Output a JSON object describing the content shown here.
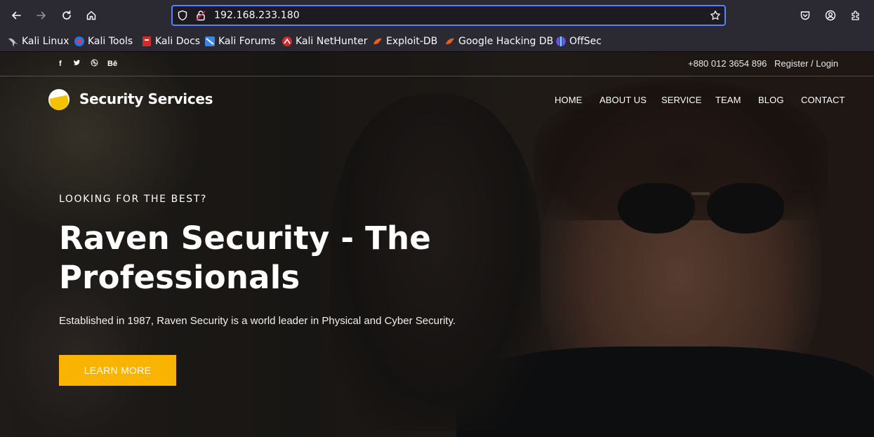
{
  "browser": {
    "url": "192.168.233.180",
    "bookmarks": [
      {
        "label": "Kali Linux",
        "icon": "kali-dragon-icon"
      },
      {
        "label": "Kali Tools",
        "icon": "kali-tools-icon"
      },
      {
        "label": "Kali Docs",
        "icon": "kali-docs-icon"
      },
      {
        "label": "Kali Forums",
        "icon": "kali-forums-icon"
      },
      {
        "label": "Kali NetHunter",
        "icon": "nethunter-icon"
      },
      {
        "label": "Exploit-DB",
        "icon": "exploit-db-icon"
      },
      {
        "label": "Google Hacking DB",
        "icon": "ghdb-icon"
      },
      {
        "label": "OffSec",
        "icon": "offsec-icon"
      }
    ]
  },
  "site": {
    "topbar": {
      "social": [
        "f",
        "t",
        "d",
        "Bē"
      ],
      "phone": "+880 012 3654 896",
      "login": "Register / Login"
    },
    "brand": "Security Services",
    "menu": [
      "HOME",
      "ABOUT US",
      "SERVICE",
      "TEAM",
      "BLOG",
      "CONTACT"
    ],
    "hero": {
      "eyebrow": "LOOKING FOR THE BEST?",
      "headline": "Raven Security - The Professionals",
      "lead": "Established in 1987, Raven Security is a world leader in Physical and Cyber Security.",
      "cta": "LEARN MORE"
    },
    "colors": {
      "accent": "#f8b400",
      "urlbar_focus": "#5b7fff"
    }
  }
}
